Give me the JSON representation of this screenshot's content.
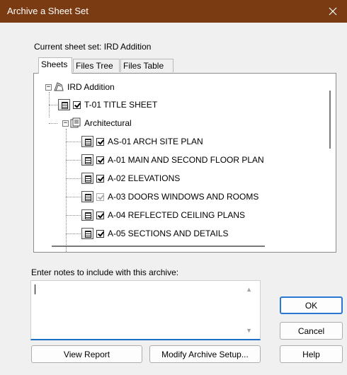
{
  "window": {
    "title": "Archive a Sheet Set"
  },
  "current_sheet_set": "Current sheet set: IRD Addition",
  "tabs": [
    {
      "label": "Sheets",
      "active": true
    },
    {
      "label": "Files Tree",
      "active": false
    },
    {
      "label": "Files Table",
      "active": false
    }
  ],
  "tree": {
    "root": {
      "label": "IRD Addition",
      "expanded": true
    },
    "title_sheet": {
      "label": "T-01 TITLE SHEET",
      "checked": true
    },
    "subset": {
      "label": "Architectural",
      "expanded": true
    },
    "sheets": [
      {
        "label": "AS-01 ARCH SITE PLAN",
        "checked": true,
        "enabled": true
      },
      {
        "label": "A-01 MAIN AND SECOND FLOOR PLAN",
        "checked": true,
        "enabled": true
      },
      {
        "label": "A-02 ELEVATIONS",
        "checked": true,
        "enabled": true
      },
      {
        "label": "A-03 DOORS WINDOWS AND ROOMS",
        "checked": true,
        "enabled": false
      },
      {
        "label": "A-04 REFLECTED CEILING PLANS",
        "checked": true,
        "enabled": true
      },
      {
        "label": "A-05 SECTIONS AND DETAILS",
        "checked": true,
        "enabled": true
      }
    ]
  },
  "notes": {
    "label": "Enter notes to include with this archive:",
    "value": ""
  },
  "buttons": {
    "view_report": "View Report",
    "modify_setup": "Modify Archive Setup...",
    "ok": "OK",
    "cancel": "Cancel",
    "help": "Help"
  },
  "icons": {
    "close": "close-icon"
  },
  "colors": {
    "titlebar": "#7a3b12",
    "focus": "#1c6fc9"
  }
}
